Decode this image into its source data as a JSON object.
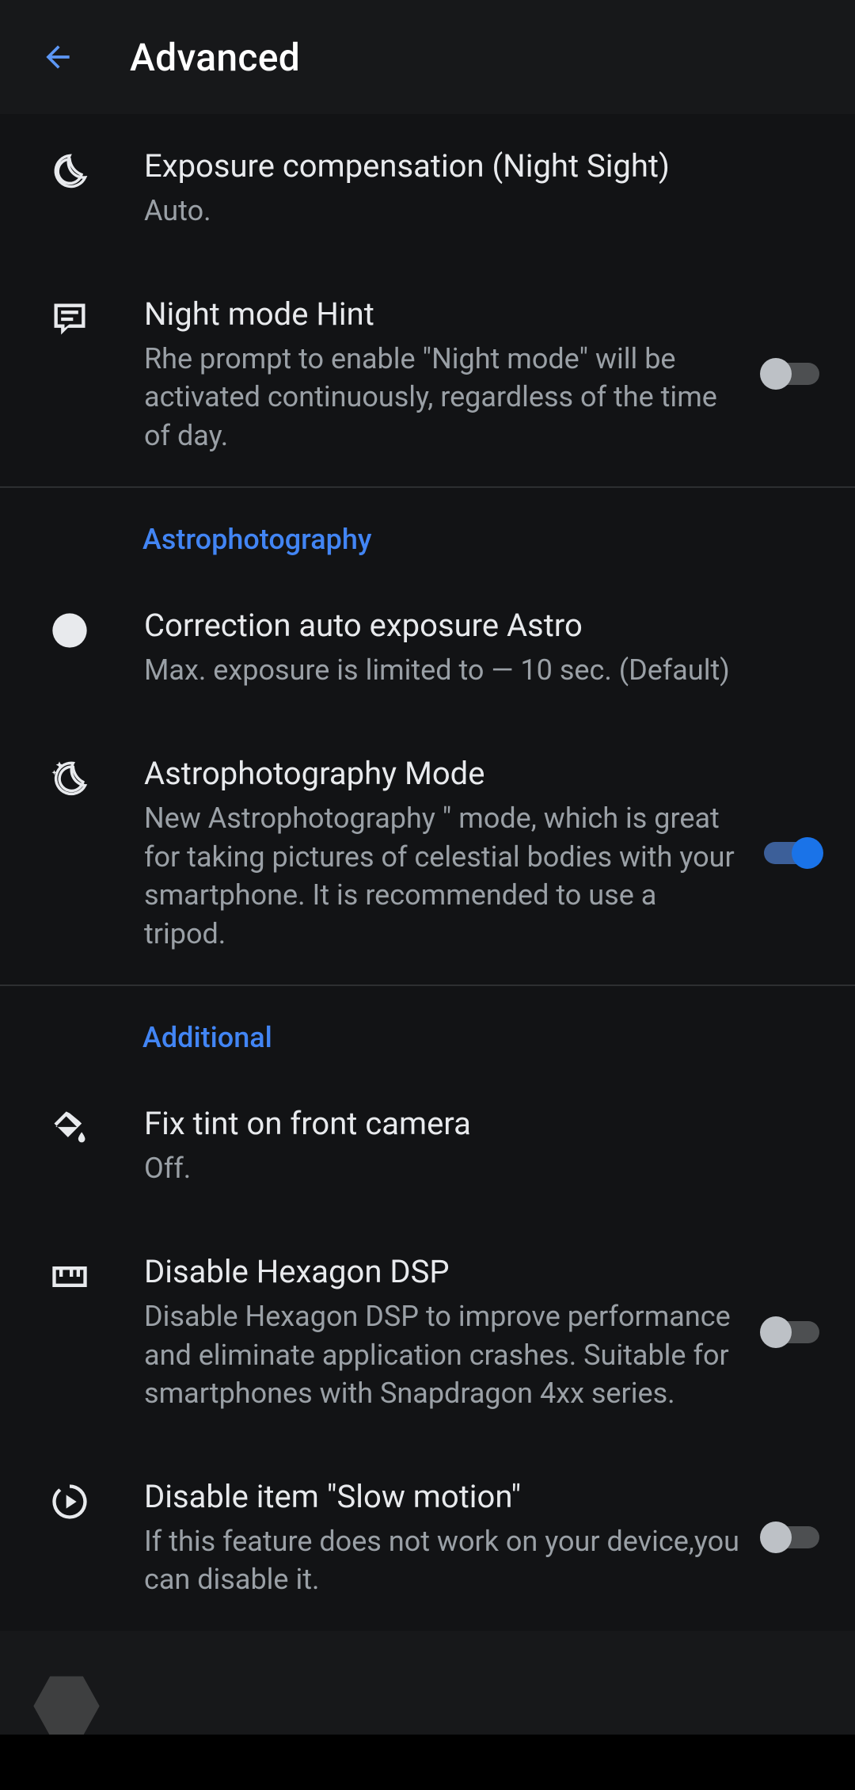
{
  "header": {
    "title": "Advanced"
  },
  "sections": {
    "top": {
      "exposure": {
        "title": "Exposure compensation (Night Sight)",
        "subtitle": "Auto."
      },
      "night_hint": {
        "title": "Night mode Hint",
        "subtitle": "Rhe prompt to enable \"Night mode\" will be activated continuously, regardless of the time of day.",
        "toggle": false
      }
    },
    "astro": {
      "header": "Astrophotography",
      "correction": {
        "title": "Correction auto exposure Astro",
        "subtitle": "Max. exposure is limited to — 10 sec. (Default)"
      },
      "mode": {
        "title": "Astrophotography Mode",
        "subtitle": "New Astrophotography \" mode, which is great for taking pictures of celestial bodies with your smartphone. It is recommended to use a tripod.",
        "toggle": true
      }
    },
    "additional": {
      "header": "Additional",
      "fix_tint": {
        "title": "Fix tint on front camera",
        "subtitle": "Off."
      },
      "hexagon": {
        "title": "Disable Hexagon DSP",
        "subtitle": "Disable Hexagon DSP to improve performance and eliminate application crashes. Suitable for smartphones with Snapdragon 4xx series.",
        "toggle": false
      },
      "slowmo": {
        "title": "Disable item \"Slow motion\"",
        "subtitle": "If this feature does not work on your device,you can disable it.",
        "toggle": false
      }
    }
  }
}
